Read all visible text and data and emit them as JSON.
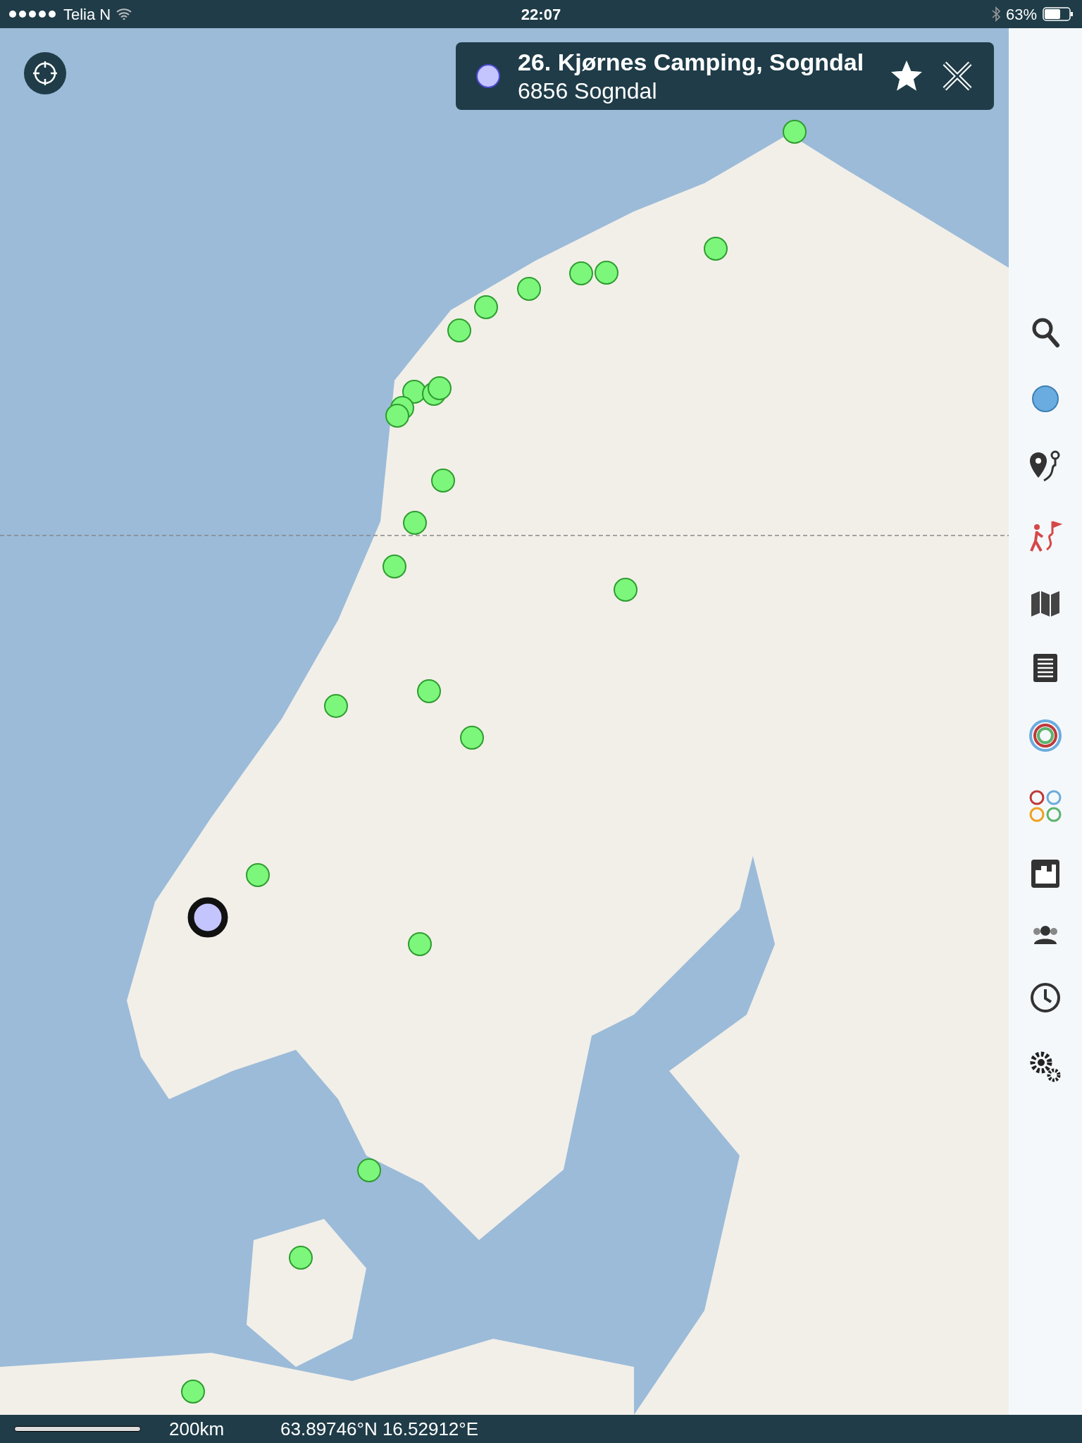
{
  "status_bar": {
    "carrier": "Telia N",
    "time": "22:07",
    "battery": "63%"
  },
  "popup": {
    "title": "26. Kjørnes Camping, Sogndal",
    "subtitle": "6856 Sogndal",
    "favorite": true
  },
  "bottom_bar": {
    "scale": "200km",
    "coordinates": "63.89746°N 16.52912°E"
  }
}
